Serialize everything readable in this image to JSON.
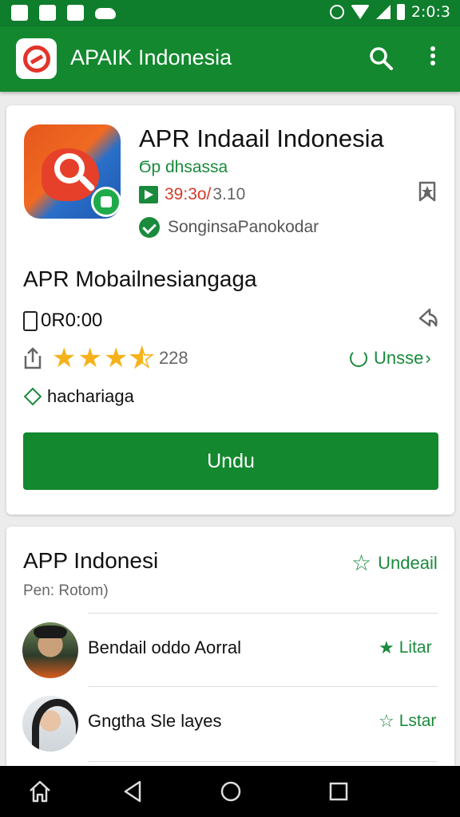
{
  "status_bar": {
    "time": "2:0:3"
  },
  "app_bar": {
    "title": "APAIK Indonesia"
  },
  "detail": {
    "app_name": "APR Indaail Indonesia",
    "developer": "Ϭp dhsassa",
    "price_new": "39:3o/",
    "price_old": "3.10",
    "verified_text": "SonginsaPanokodar",
    "subtitle": "APR Mobailnesiangaga",
    "size": "0R0:00",
    "rating_count": "228",
    "update_label": "Unsse",
    "tag": "hachariaga",
    "download_label": "Undu"
  },
  "list": {
    "title": "APP Indonesi",
    "subtitle": "Pen: Rotom)",
    "action_label": "Undeail",
    "items": [
      {
        "name": "Bendail oddo Aorral",
        "action": "Litar"
      },
      {
        "name": "Gngtha Sle layes",
        "action": "Lstar"
      }
    ]
  },
  "theme": {
    "primary": "#13882f",
    "accent_red": "#d43b2b",
    "star": "#f5b21a",
    "nav_bg": "#000000"
  },
  "icons": [
    "image-icon",
    "notification-icon",
    "photo-icon",
    "cloud-icon",
    "alarm-icon",
    "wifi-icon",
    "signal-icon",
    "battery-icon",
    "search-icon",
    "more-vert-icon",
    "bookmark-icon",
    "play-store-icon",
    "check-icon",
    "phone-icon",
    "navigate-icon",
    "share-icon",
    "star-icon",
    "refresh-icon",
    "diamond-icon",
    "star-outline-icon",
    "home-icon",
    "back-icon",
    "circle-home-icon",
    "recents-icon"
  ]
}
